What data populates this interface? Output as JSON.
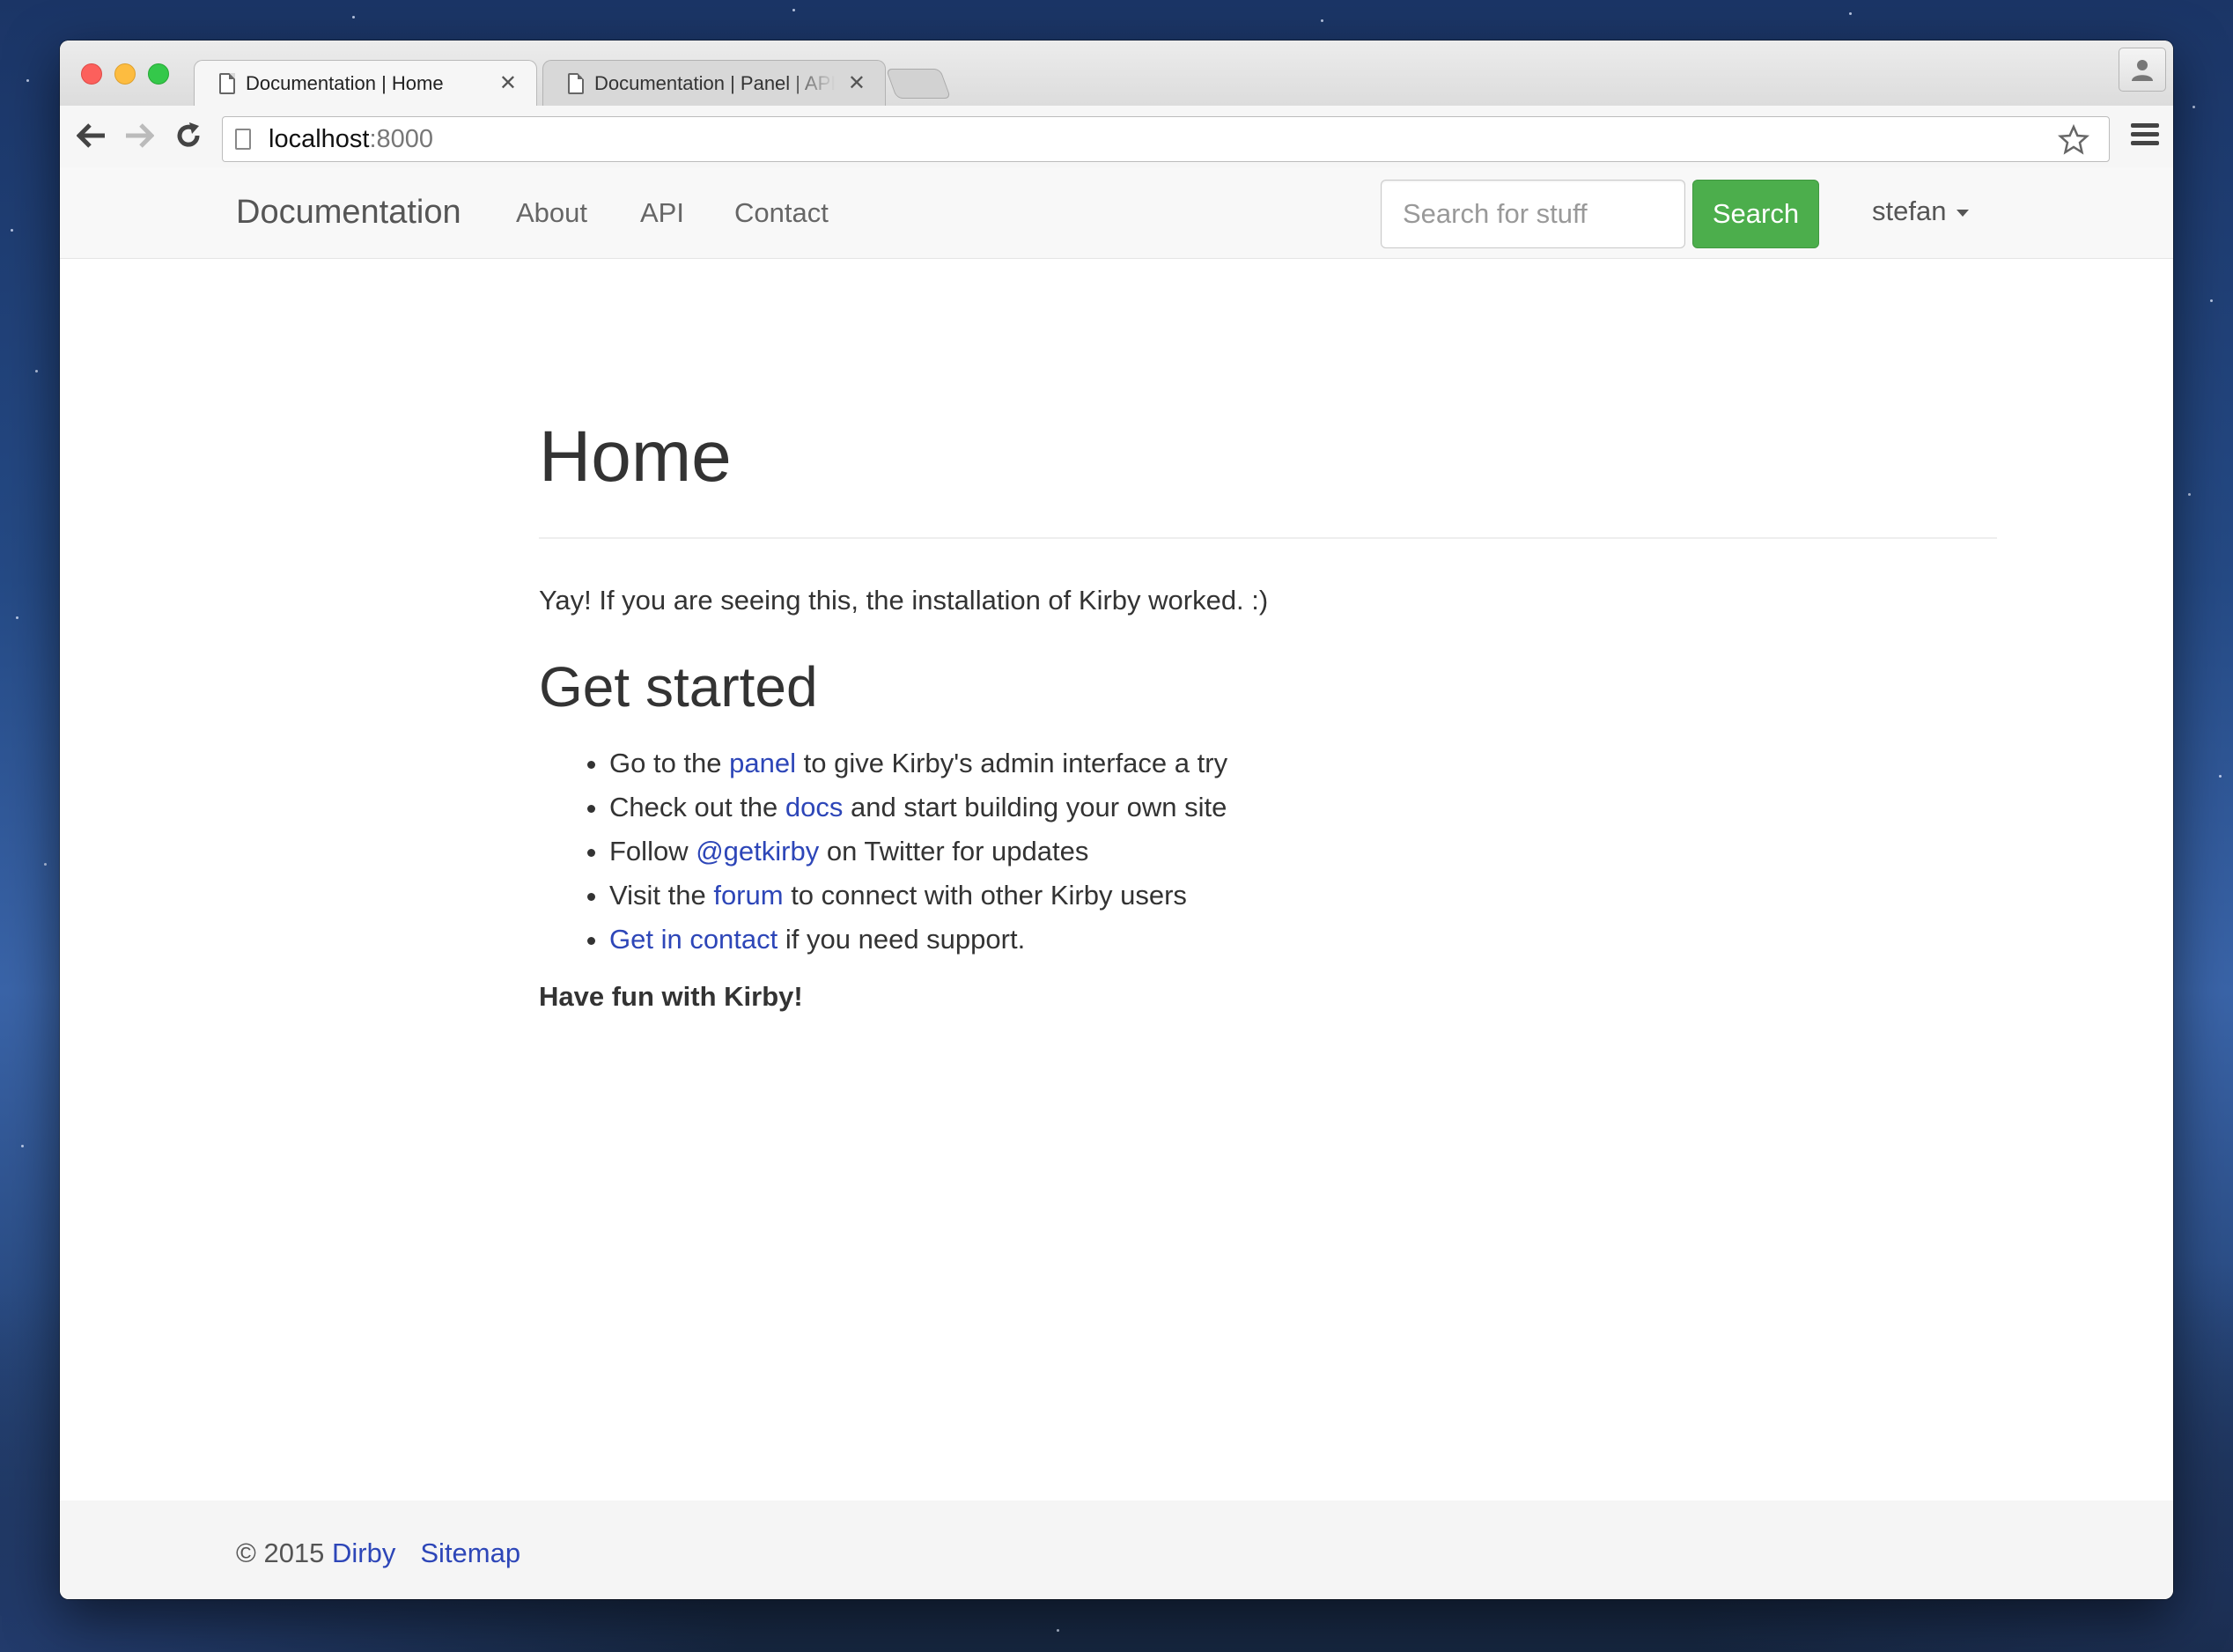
{
  "browser": {
    "tabs": [
      {
        "title": "Documentation | Home",
        "active": true
      },
      {
        "title": "Documentation | Panel | API",
        "active": false
      }
    ],
    "url_host": "localhost",
    "url_port": ":8000"
  },
  "site": {
    "brand": "Documentation",
    "nav": [
      "About",
      "API",
      "Contact"
    ],
    "search": {
      "placeholder": "Search for stuff",
      "button": "Search"
    },
    "user": "stefan"
  },
  "page": {
    "title": "Home",
    "intro": "Yay! If you are seeing this, the installation of Kirby worked. :)",
    "section_title": "Get started",
    "steps": [
      {
        "before": "Go to the ",
        "link": "panel",
        "after": " to give Kirby's admin interface a try"
      },
      {
        "before": "Check out the ",
        "link": "docs",
        "after": " and start building your own site"
      },
      {
        "before": "Follow ",
        "link": "@getkirby",
        "after": " on Twitter for updates"
      },
      {
        "before": "Visit the ",
        "link": "forum",
        "after": " to connect with other Kirby users"
      },
      {
        "before": "",
        "link": "Get in contact",
        "after": " if you need support."
      }
    ],
    "closing": "Have fun with Kirby!"
  },
  "footer": {
    "copyright": "© 2015 ",
    "site_link": "Dirby",
    "sitemap": "Sitemap"
  },
  "colors": {
    "link": "#2d46b8",
    "search_button": "#4cae4c"
  }
}
